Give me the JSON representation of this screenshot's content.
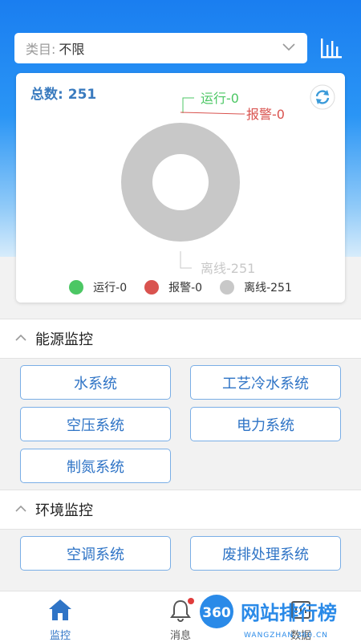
{
  "filter": {
    "label": "类目:",
    "value": "不限"
  },
  "card": {
    "total_label": "总数:",
    "total_value": "251",
    "callouts": {
      "running": "运行-0",
      "alarm": "报警-0",
      "offline": "离线-251"
    },
    "legend": [
      {
        "label": "运行-0",
        "color": "#4cc764"
      },
      {
        "label": "报警-0",
        "color": "#d9534f"
      },
      {
        "label": "离线-251",
        "color": "#c8c8c8"
      }
    ]
  },
  "chart_data": {
    "type": "pie",
    "categories": [
      "运行",
      "报警",
      "离线"
    ],
    "values": [
      0,
      0,
      251
    ],
    "title": "总数: 251"
  },
  "sections": [
    {
      "title": "能源监控",
      "buttons": [
        "水系统",
        "工艺冷水系统",
        "空压系统",
        "电力系统",
        "制氮系统"
      ]
    },
    {
      "title": "环境监控",
      "buttons": [
        "空调系统",
        "废排处理系统"
      ]
    }
  ],
  "tabs": [
    {
      "label": "监控",
      "color": "#2f74c6"
    },
    {
      "label": "消息",
      "color": "#555555"
    },
    {
      "label": "数据",
      "color": "#555555"
    }
  ],
  "watermark": {
    "text": "网站排行榜",
    "badge": "360",
    "sub": "WANGZHAN.360.CN"
  }
}
